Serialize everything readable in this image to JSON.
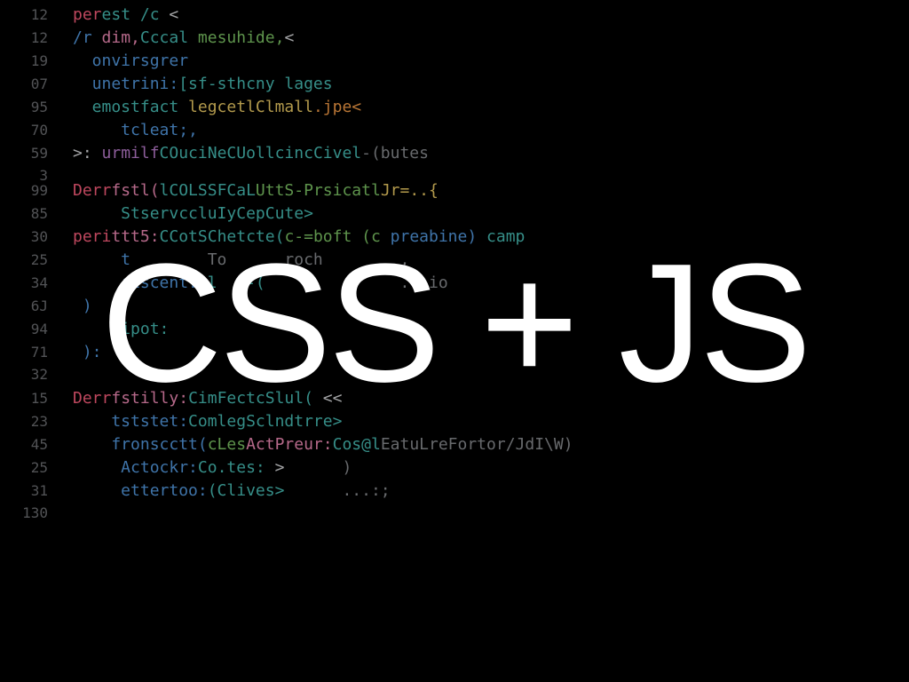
{
  "overlay": {
    "text": "CSS + JS"
  },
  "lines": [
    {
      "no": "12",
      "tokens": [
        {
          "t": "per",
          "c": "c-red"
        },
        {
          "t": "est /c ",
          "c": "c-teal"
        },
        {
          "t": "<",
          "c": "c-white"
        }
      ]
    },
    {
      "no": "12",
      "tokens": [
        {
          "t": "/r ",
          "c": "c-blue"
        },
        {
          "t": "dim,",
          "c": "c-pink"
        },
        {
          "t": "Cccal ",
          "c": "c-teal"
        },
        {
          "t": "mesuhide,",
          "c": "c-green"
        },
        {
          "t": "<",
          "c": "c-white"
        }
      ]
    },
    {
      "no": "19",
      "tokens": [
        {
          "t": "  onvirsgrer",
          "c": "c-blue"
        }
      ]
    },
    {
      "no": "07",
      "tokens": [
        {
          "t": "  unetrini:",
          "c": "c-blue"
        },
        {
          "t": "[sf-sthcny lages",
          "c": "c-teal"
        }
      ]
    },
    {
      "no": "95",
      "tokens": [
        {
          "t": "  emostfact ",
          "c": "c-teal"
        },
        {
          "t": "legcetlClmall",
          "c": "c-yellow"
        },
        {
          "t": ".jpe<",
          "c": "c-orange"
        }
      ]
    },
    {
      "no": "70",
      "tokens": [
        {
          "t": "     tcleat;,",
          "c": "c-blue"
        }
      ]
    },
    {
      "no": "59",
      "tokens": [
        {
          "t": ">: ",
          "c": "c-white"
        },
        {
          "t": "urmilf",
          "c": "c-purple"
        },
        {
          "t": "COuciNeCUollcincCivel",
          "c": "c-teal"
        },
        {
          "t": "-(butes",
          "c": "c-grey"
        }
      ]
    },
    {
      "no": "3",
      "tight": true,
      "tokens": []
    },
    {
      "no": "99",
      "tokens": [
        {
          "t": "Derr",
          "c": "c-red"
        },
        {
          "t": "fstl(",
          "c": "c-pink"
        },
        {
          "t": "lCOLSSFCaL",
          "c": "c-teal"
        },
        {
          "t": "UttS-Prsicatl",
          "c": "c-green"
        },
        {
          "t": "Jr=..{",
          "c": "c-yellow"
        }
      ]
    },
    {
      "no": "85",
      "tokens": [
        {
          "t": "     StservccluIyCepCute>",
          "c": "c-teal"
        }
      ]
    },
    {
      "no": "30",
      "tokens": [
        {
          "t": "peri",
          "c": "c-red"
        },
        {
          "t": "ttt5:",
          "c": "c-pink"
        },
        {
          "t": "CCotSChetcte(",
          "c": "c-teal"
        },
        {
          "t": "c-=boft (c ",
          "c": "c-green"
        },
        {
          "t": "preabine) ",
          "c": "c-blue"
        },
        {
          "t": "camp",
          "c": "c-teal"
        }
      ]
    },
    {
      "no": "25",
      "tokens": [
        {
          "t": "     t        ",
          "c": "c-blue"
        },
        {
          "t": "To      roch        ,",
          "c": "c-grey"
        }
      ]
    },
    {
      "no": "34",
      "tokens": [
        {
          "t": "     riscent: ",
          "c": "c-blue"
        },
        {
          "t": "l   -(",
          "c": "c-teal"
        },
        {
          "t": "              ...io",
          "c": "c-grey"
        }
      ]
    },
    {
      "no": "6J",
      "tokens": [
        {
          "t": " )",
          "c": "c-blue"
        }
      ]
    },
    {
      "no": "94",
      "tokens": [
        {
          "t": "    \"ipot:",
          "c": "c-teal"
        }
      ]
    },
    {
      "no": "71",
      "tokens": [
        {
          "t": " ):",
          "c": "c-blue"
        }
      ]
    },
    {
      "no": "32",
      "tokens": []
    },
    {
      "no": "15",
      "tokens": [
        {
          "t": "Derr",
          "c": "c-red"
        },
        {
          "t": "fstilly:",
          "c": "c-pink"
        },
        {
          "t": "CimFectcSlul( ",
          "c": "c-teal"
        },
        {
          "t": "<<",
          "c": "c-white"
        }
      ]
    },
    {
      "no": "23",
      "tokens": [
        {
          "t": "    tststet:",
          "c": "c-blue"
        },
        {
          "t": "ComlegSclndtrre>",
          "c": "c-teal"
        }
      ]
    },
    {
      "no": "45",
      "tokens": [
        {
          "t": "    fronscctt(",
          "c": "c-blue"
        },
        {
          "t": "cLes",
          "c": "c-green"
        },
        {
          "t": "ActPreur:",
          "c": "c-pink"
        },
        {
          "t": "Cos@l",
          "c": "c-teal"
        },
        {
          "t": "EatuLreFortor/JdI\\W)",
          "c": "c-grey"
        }
      ]
    },
    {
      "no": "25",
      "tokens": [
        {
          "t": "     Actockr:",
          "c": "c-blue"
        },
        {
          "t": "Co.tes: ",
          "c": "c-teal"
        },
        {
          "t": "> ",
          "c": "c-white"
        },
        {
          "t": "     )",
          "c": "c-grey"
        }
      ]
    },
    {
      "no": "31",
      "tokens": [
        {
          "t": "     ettertoo:",
          "c": "c-blue"
        },
        {
          "t": "(Clives>",
          "c": "c-teal"
        },
        {
          "t": "      ...:;",
          "c": "c-grey"
        }
      ]
    },
    {
      "no": "130",
      "tokens": []
    }
  ]
}
